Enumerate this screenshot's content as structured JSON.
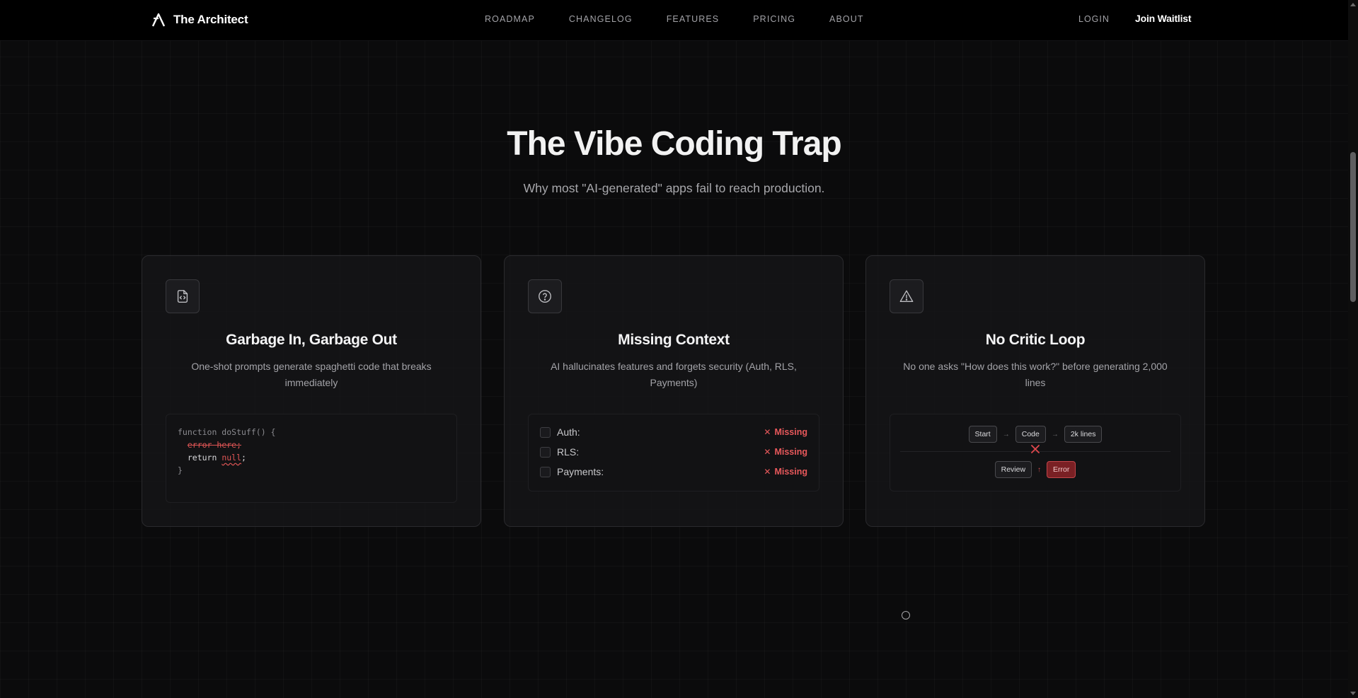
{
  "nav": {
    "brand": "The Architect",
    "links": [
      "ROADMAP",
      "CHANGELOG",
      "FEATURES",
      "PRICING",
      "ABOUT"
    ],
    "login": "LOGIN",
    "cta": "Join Waitlist"
  },
  "hero": {
    "title": "The Vibe Coding Trap",
    "subtitle": "Why most \"AI-generated\" apps fail to reach production."
  },
  "cards": [
    {
      "icon": "file-code-icon",
      "title": "Garbage In, Garbage Out",
      "description": "One-shot prompts generate spaghetti code that breaks immediately",
      "code": {
        "line1": "function doStuff() {",
        "error_line": "error here;",
        "return_keyword": "return ",
        "null_token": "null",
        "semicolon": ";",
        "closing": "}"
      }
    },
    {
      "icon": "question-circle-icon",
      "title": "Missing Context",
      "description": "AI hallucinates features and forgets security (Auth, RLS, Payments)",
      "checklist": [
        {
          "label": "Auth:",
          "status": "Missing"
        },
        {
          "label": "RLS:",
          "status": "Missing"
        },
        {
          "label": "Payments:",
          "status": "Missing"
        }
      ]
    },
    {
      "icon": "warning-triangle-icon",
      "title": "No Critic Loop",
      "description": "No one asks \"How does this work?\" before generating 2,000 lines",
      "flow": {
        "top": [
          "Start",
          "Code",
          "2k lines"
        ],
        "bottom": [
          "Review",
          "Error"
        ]
      }
    }
  ],
  "colors": {
    "background": "#0b0b0c",
    "accent_error": "#e8585b",
    "error_node": "#7a2024"
  }
}
